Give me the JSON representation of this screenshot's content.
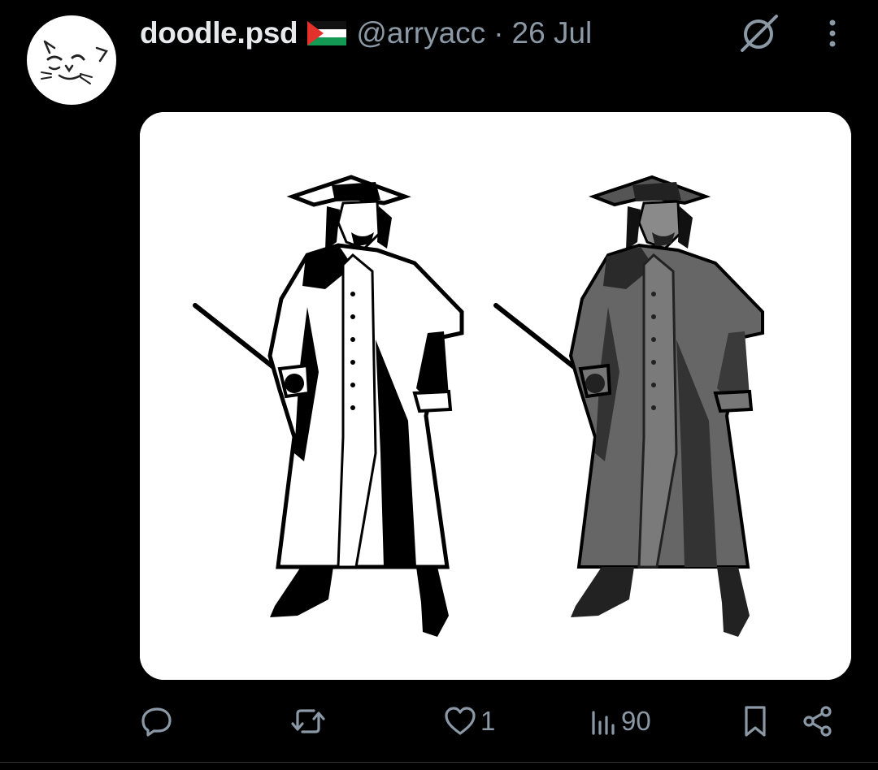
{
  "post": {
    "author_name": "doodle.psd",
    "author_handle": "@arryacc",
    "separator": "·",
    "date": "26 Jul",
    "flag_icon": "palestine-flag-icon",
    "avatar_icon": "cat-face-icon"
  },
  "actions": {
    "reply": {
      "icon": "reply-icon",
      "count": ""
    },
    "repost": {
      "icon": "repost-icon",
      "count": ""
    },
    "like": {
      "icon": "heart-icon",
      "count": "1"
    },
    "views": {
      "icon": "views-icon",
      "count": "90"
    },
    "bookmark": {
      "icon": "bookmark-icon"
    },
    "share": {
      "icon": "share-icon"
    }
  },
  "colors": {
    "background": "#000000",
    "text_primary": "#e7e9ea",
    "text_secondary": "#8b98a5",
    "media_background": "#ffffff"
  }
}
